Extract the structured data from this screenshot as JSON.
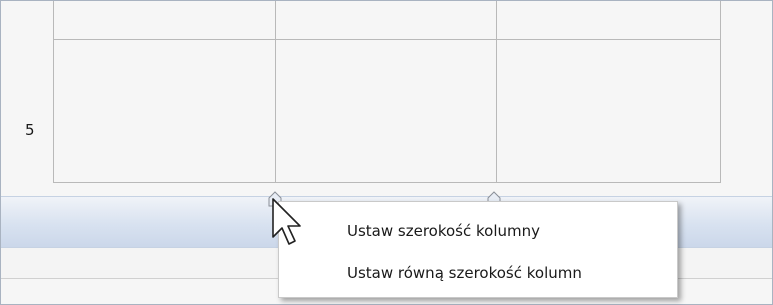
{
  "table": {
    "row_label": "5"
  },
  "context_menu": {
    "items": [
      {
        "label": "Ustaw szerokość kolumny"
      },
      {
        "label": "Ustaw równą szerokość kolumn"
      }
    ]
  },
  "icons": {
    "cursor": "mouse-pointer-icon",
    "column_marker": "column-resize-marker-icon"
  },
  "colors": {
    "ruler_bar": "#d8e2f0",
    "grid_line": "#b9b9b9",
    "menu_bg": "#ffffff"
  }
}
